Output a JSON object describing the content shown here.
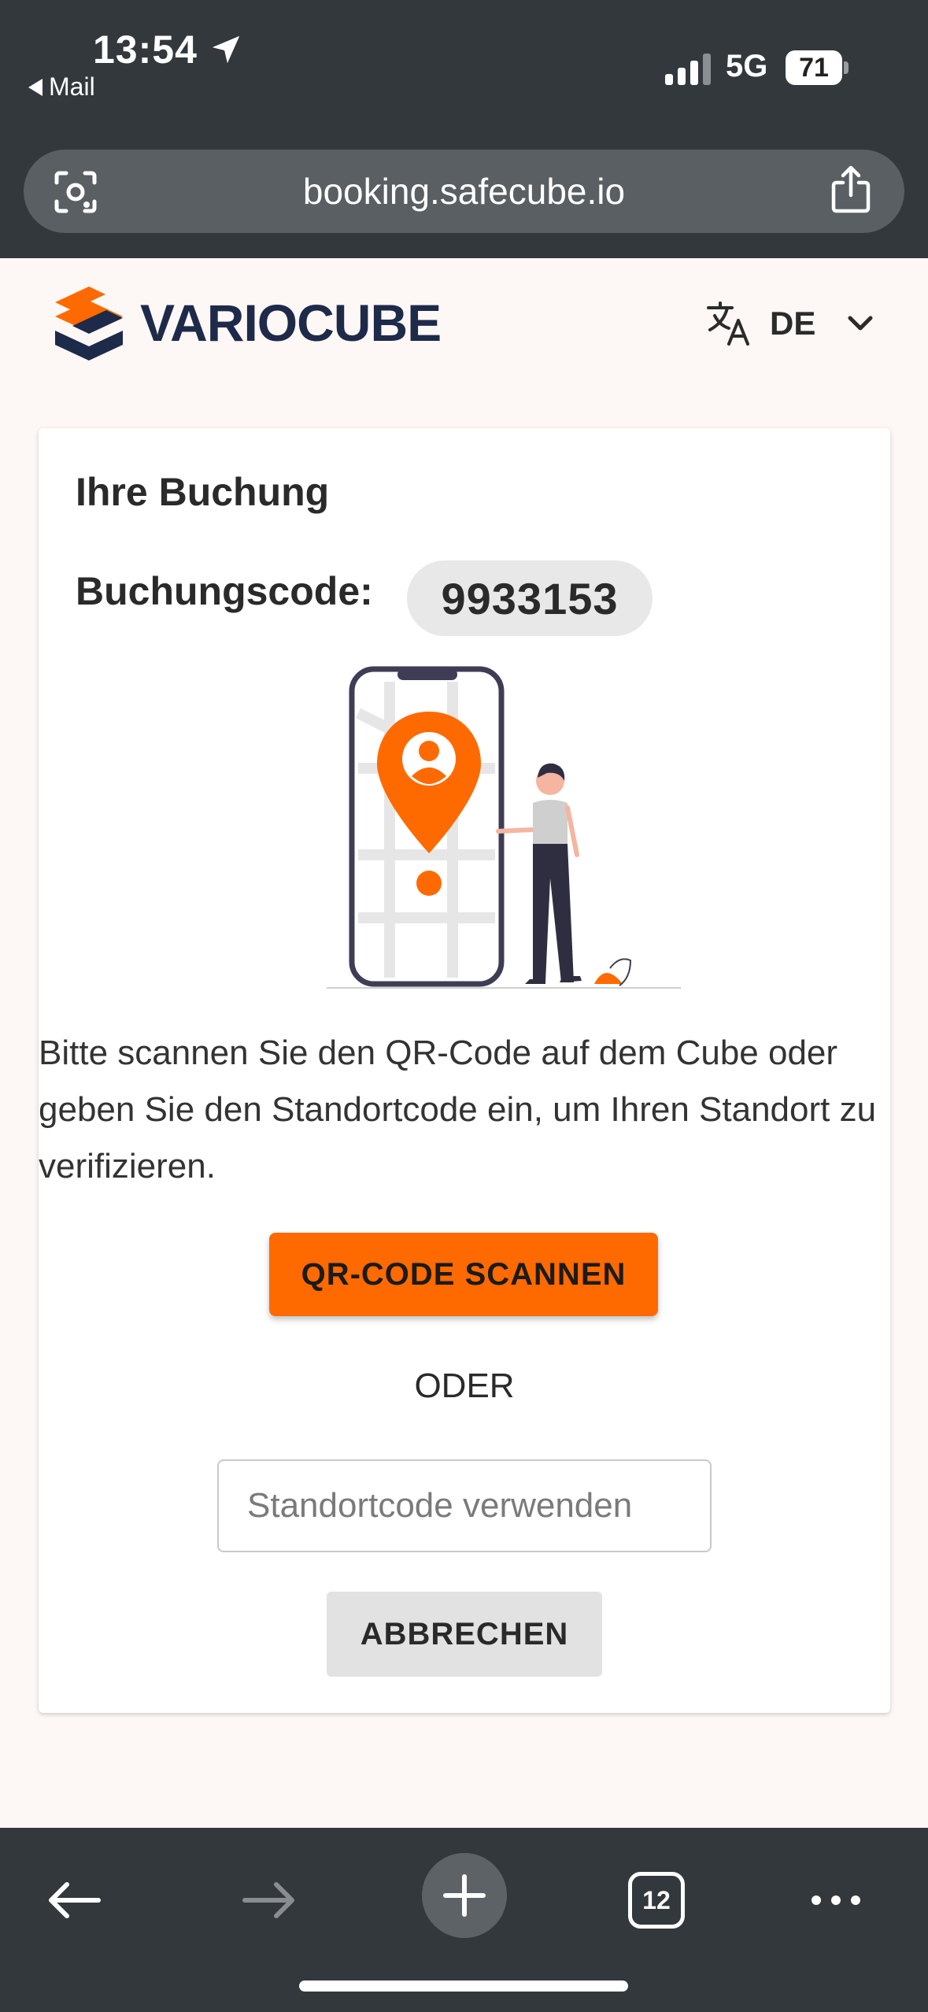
{
  "status_bar": {
    "time": "13:54",
    "back_app": "Mail",
    "network": "5G",
    "battery": "71",
    "location_icon": "location-arrow-icon",
    "signal_icon": "cellular-signal-icon"
  },
  "browser": {
    "url": "booking.safecube.io",
    "lens_icon": "camera-search-icon",
    "share_icon": "share-icon"
  },
  "header": {
    "brand": "VARIOCUBE",
    "language_code": "DE",
    "translate_icon": "translate-icon",
    "dropdown_icon": "chevron-down-icon"
  },
  "booking": {
    "title": "Ihre Buchung",
    "code_label": "Buchungscode:",
    "code_value": "9933153",
    "description": "Bitte scannen Sie den QR-Code auf dem Cube oder geben Sie den Standortcode ein, um Ihren Standort zu verifizieren.",
    "scan_button": "QR-CODE SCANNEN",
    "or_text": "ODER",
    "location_code_placeholder": "Standortcode verwenden",
    "location_code_value": "",
    "cancel_button": "ABBRECHEN"
  },
  "toolbar": {
    "back_icon": "arrow-left-icon",
    "forward_icon": "arrow-right-icon",
    "new_tab_icon": "plus-icon",
    "tab_count": "12",
    "more_icon": "more-dots-icon"
  },
  "colors": {
    "accent": "#ff6a00",
    "brand_navy": "#1e2a4a",
    "chrome": "#33383c",
    "page_bg": "#fdf7f5"
  }
}
